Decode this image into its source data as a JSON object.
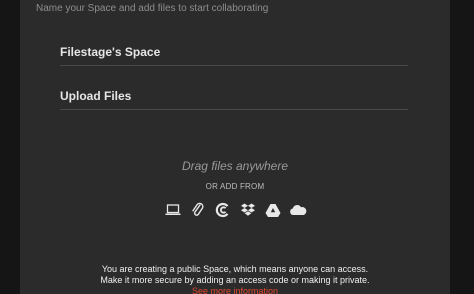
{
  "header": {
    "subtitle": "Name your Space and add files to start collaborating"
  },
  "form": {
    "space_name": "Filestage's Space",
    "upload_label": "Upload Files"
  },
  "dropzone": {
    "drag_text": "Drag files anywhere",
    "or_add_from": "OR ADD FROM",
    "sources": [
      "computer-icon",
      "link-icon",
      "filestage-icon",
      "dropbox-icon",
      "google-drive-icon",
      "onedrive-icon"
    ]
  },
  "notice": {
    "line1": "You are creating a public Space, which means anyone can access.",
    "line2": "Make it more secure by adding an access code or making it private.",
    "link": "See more information"
  },
  "colors": {
    "background": "#2b2b2b",
    "link": "#e0472f"
  }
}
